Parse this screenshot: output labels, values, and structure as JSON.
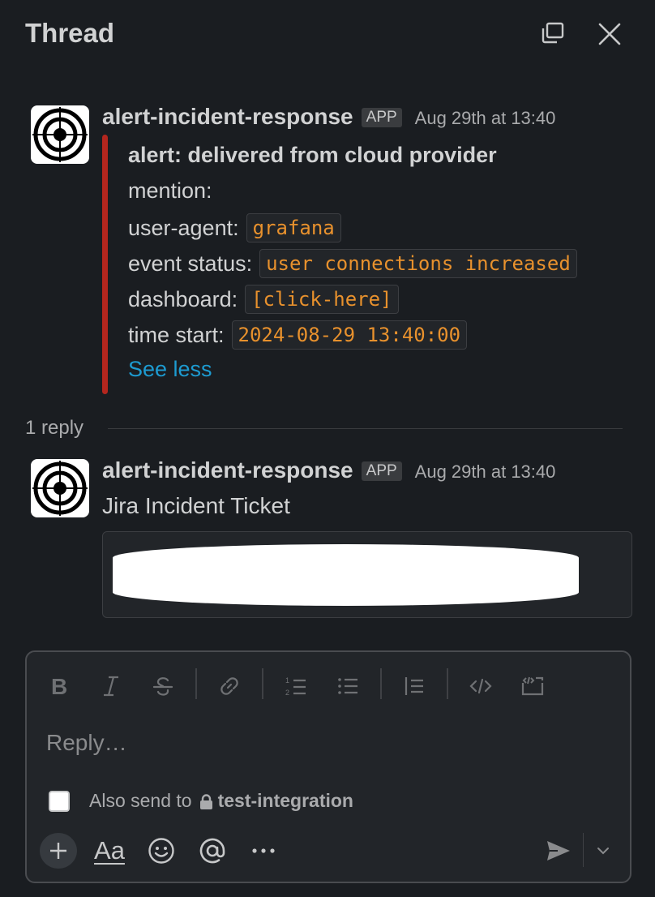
{
  "header": {
    "title": "Thread"
  },
  "parent_message": {
    "sender": "alert-incident-response",
    "badge": "APP",
    "timestamp": "Aug 29th at 13:40",
    "accent_color": "#b3261e",
    "fields": {
      "alert": "alert: delivered from cloud provider",
      "mention_label": "mention:",
      "user_agent_label": "user-agent:",
      "user_agent_value": "grafana",
      "event_status_label": "event status:",
      "event_status_value": "user connections increased",
      "dashboard_label": "dashboard:",
      "dashboard_value": "[click-here]",
      "time_start_label": "time start:",
      "time_start_value": "2024-08-29 13:40:00"
    },
    "see_less": "See less"
  },
  "replies": {
    "count_label": "1 reply",
    "items": [
      {
        "sender": "alert-incident-response",
        "badge": "APP",
        "timestamp": "Aug 29th at 13:40",
        "text": "Jira Incident Ticket"
      }
    ]
  },
  "composer": {
    "placeholder": "Reply…",
    "also_send_label": "Also send to",
    "channel": "test-integration",
    "also_send_checked": false,
    "format_button": "Aa",
    "toolbar_icons": [
      "bold-icon",
      "italic-icon",
      "strikethrough-icon",
      "link-icon",
      "ordered-list-icon",
      "bulleted-list-icon",
      "blockquote-icon",
      "code-icon",
      "code-block-icon"
    ],
    "bottom_icons": [
      "plus-icon",
      "emoji-icon",
      "mention-icon",
      "more-icon",
      "send-icon",
      "chevron-down-icon"
    ]
  },
  "colors": {
    "background": "#1a1d21",
    "link": "#1d9bd1",
    "code_text": "#e8912d"
  }
}
